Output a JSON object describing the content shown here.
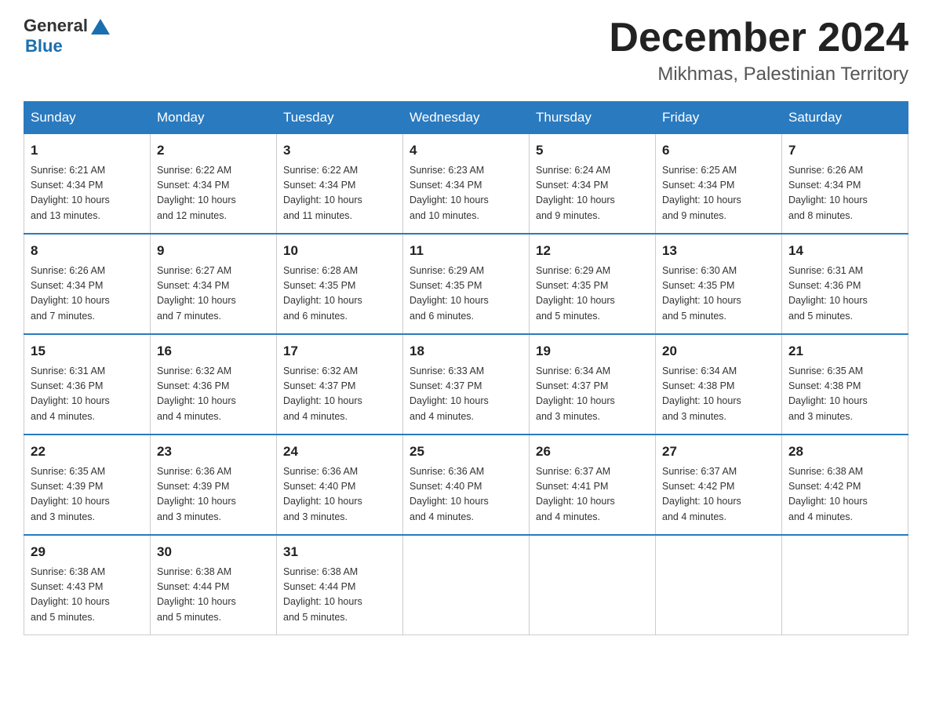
{
  "logo": {
    "general": "General",
    "blue": "Blue"
  },
  "header": {
    "month": "December 2024",
    "location": "Mikhmas, Palestinian Territory"
  },
  "days_of_week": [
    "Sunday",
    "Monday",
    "Tuesday",
    "Wednesday",
    "Thursday",
    "Friday",
    "Saturday"
  ],
  "weeks": [
    [
      {
        "day": "1",
        "sunrise": "6:21 AM",
        "sunset": "4:34 PM",
        "daylight": "10 hours and 13 minutes."
      },
      {
        "day": "2",
        "sunrise": "6:22 AM",
        "sunset": "4:34 PM",
        "daylight": "10 hours and 12 minutes."
      },
      {
        "day": "3",
        "sunrise": "6:22 AM",
        "sunset": "4:34 PM",
        "daylight": "10 hours and 11 minutes."
      },
      {
        "day": "4",
        "sunrise": "6:23 AM",
        "sunset": "4:34 PM",
        "daylight": "10 hours and 10 minutes."
      },
      {
        "day": "5",
        "sunrise": "6:24 AM",
        "sunset": "4:34 PM",
        "daylight": "10 hours and 9 minutes."
      },
      {
        "day": "6",
        "sunrise": "6:25 AM",
        "sunset": "4:34 PM",
        "daylight": "10 hours and 9 minutes."
      },
      {
        "day": "7",
        "sunrise": "6:26 AM",
        "sunset": "4:34 PM",
        "daylight": "10 hours and 8 minutes."
      }
    ],
    [
      {
        "day": "8",
        "sunrise": "6:26 AM",
        "sunset": "4:34 PM",
        "daylight": "10 hours and 7 minutes."
      },
      {
        "day": "9",
        "sunrise": "6:27 AM",
        "sunset": "4:34 PM",
        "daylight": "10 hours and 7 minutes."
      },
      {
        "day": "10",
        "sunrise": "6:28 AM",
        "sunset": "4:35 PM",
        "daylight": "10 hours and 6 minutes."
      },
      {
        "day": "11",
        "sunrise": "6:29 AM",
        "sunset": "4:35 PM",
        "daylight": "10 hours and 6 minutes."
      },
      {
        "day": "12",
        "sunrise": "6:29 AM",
        "sunset": "4:35 PM",
        "daylight": "10 hours and 5 minutes."
      },
      {
        "day": "13",
        "sunrise": "6:30 AM",
        "sunset": "4:35 PM",
        "daylight": "10 hours and 5 minutes."
      },
      {
        "day": "14",
        "sunrise": "6:31 AM",
        "sunset": "4:36 PM",
        "daylight": "10 hours and 5 minutes."
      }
    ],
    [
      {
        "day": "15",
        "sunrise": "6:31 AM",
        "sunset": "4:36 PM",
        "daylight": "10 hours and 4 minutes."
      },
      {
        "day": "16",
        "sunrise": "6:32 AM",
        "sunset": "4:36 PM",
        "daylight": "10 hours and 4 minutes."
      },
      {
        "day": "17",
        "sunrise": "6:32 AM",
        "sunset": "4:37 PM",
        "daylight": "10 hours and 4 minutes."
      },
      {
        "day": "18",
        "sunrise": "6:33 AM",
        "sunset": "4:37 PM",
        "daylight": "10 hours and 4 minutes."
      },
      {
        "day": "19",
        "sunrise": "6:34 AM",
        "sunset": "4:37 PM",
        "daylight": "10 hours and 3 minutes."
      },
      {
        "day": "20",
        "sunrise": "6:34 AM",
        "sunset": "4:38 PM",
        "daylight": "10 hours and 3 minutes."
      },
      {
        "day": "21",
        "sunrise": "6:35 AM",
        "sunset": "4:38 PM",
        "daylight": "10 hours and 3 minutes."
      }
    ],
    [
      {
        "day": "22",
        "sunrise": "6:35 AM",
        "sunset": "4:39 PM",
        "daylight": "10 hours and 3 minutes."
      },
      {
        "day": "23",
        "sunrise": "6:36 AM",
        "sunset": "4:39 PM",
        "daylight": "10 hours and 3 minutes."
      },
      {
        "day": "24",
        "sunrise": "6:36 AM",
        "sunset": "4:40 PM",
        "daylight": "10 hours and 3 minutes."
      },
      {
        "day": "25",
        "sunrise": "6:36 AM",
        "sunset": "4:40 PM",
        "daylight": "10 hours and 4 minutes."
      },
      {
        "day": "26",
        "sunrise": "6:37 AM",
        "sunset": "4:41 PM",
        "daylight": "10 hours and 4 minutes."
      },
      {
        "day": "27",
        "sunrise": "6:37 AM",
        "sunset": "4:42 PM",
        "daylight": "10 hours and 4 minutes."
      },
      {
        "day": "28",
        "sunrise": "6:38 AM",
        "sunset": "4:42 PM",
        "daylight": "10 hours and 4 minutes."
      }
    ],
    [
      {
        "day": "29",
        "sunrise": "6:38 AM",
        "sunset": "4:43 PM",
        "daylight": "10 hours and 5 minutes."
      },
      {
        "day": "30",
        "sunrise": "6:38 AM",
        "sunset": "4:44 PM",
        "daylight": "10 hours and 5 minutes."
      },
      {
        "day": "31",
        "sunrise": "6:38 AM",
        "sunset": "4:44 PM",
        "daylight": "10 hours and 5 minutes."
      },
      null,
      null,
      null,
      null
    ]
  ],
  "labels": {
    "sunrise": "Sunrise:",
    "sunset": "Sunset:",
    "daylight": "Daylight:"
  }
}
